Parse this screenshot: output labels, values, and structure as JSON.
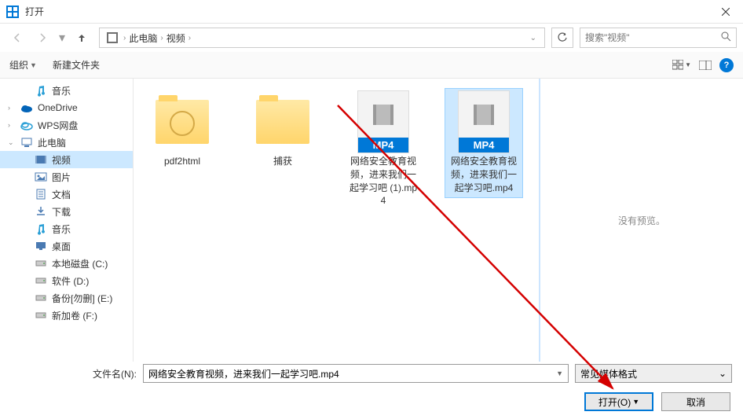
{
  "window": {
    "title": "打开"
  },
  "nav": {
    "crumbs": [
      "此电脑",
      "视频"
    ],
    "search_placeholder": "搜索\"视频\""
  },
  "toolbar": {
    "organize": "组织",
    "newfolder": "新建文件夹"
  },
  "sidebar": {
    "items": [
      {
        "label": "音乐",
        "icon": "music",
        "indent": true
      },
      {
        "label": "OneDrive",
        "icon": "onedrive"
      },
      {
        "label": "WPS网盘",
        "icon": "wps"
      },
      {
        "label": "此电脑",
        "icon": "pc",
        "exp": true
      },
      {
        "label": "视频",
        "icon": "video",
        "indent": true,
        "selected": true
      },
      {
        "label": "图片",
        "icon": "picture",
        "indent": true
      },
      {
        "label": "文档",
        "icon": "doc",
        "indent": true
      },
      {
        "label": "下载",
        "icon": "download",
        "indent": true
      },
      {
        "label": "音乐",
        "icon": "music",
        "indent": true
      },
      {
        "label": "桌面",
        "icon": "desktop",
        "indent": true
      },
      {
        "label": "本地磁盘 (C:)",
        "icon": "disk",
        "indent": true
      },
      {
        "label": "软件 (D:)",
        "icon": "disk",
        "indent": true
      },
      {
        "label": "备份[勿删] (E:)",
        "icon": "disk",
        "indent": true
      },
      {
        "label": "新加卷 (F:)",
        "icon": "disk",
        "indent": true
      }
    ]
  },
  "files": {
    "items": [
      {
        "name": "pdf2html",
        "type": "folder-web"
      },
      {
        "name": "捕获",
        "type": "folder"
      },
      {
        "name": "网络安全教育视频，进来我们一起学习吧 (1).mp4",
        "type": "mp4"
      },
      {
        "name": "网络安全教育视频，进来我们一起学习吧.mp4",
        "type": "mp4",
        "selected": true
      }
    ]
  },
  "preview": {
    "text": "没有预览。"
  },
  "footer": {
    "filename_label": "文件名(N):",
    "filename_value": "网络安全教育视频，进来我们一起学习吧.mp4",
    "filter": "常见媒体格式",
    "open_btn": "打开(O)",
    "cancel_btn": "取消"
  }
}
